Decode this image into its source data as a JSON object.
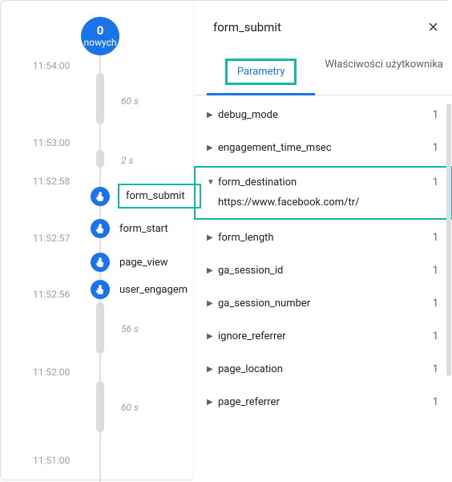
{
  "badge": {
    "count": "0",
    "label": "nowych"
  },
  "timestamps": {
    "t1": "11:54:00",
    "t2": "11:53:00",
    "t3": "11:52:58",
    "t4": "11:52:57",
    "t5": "11:52:56",
    "t6": "11:52:00",
    "t7": "11:51:00"
  },
  "gaps": {
    "g1": "60 s",
    "g2": "2 s",
    "g3": "56 s",
    "g4": "60 s"
  },
  "events": {
    "e1": "form_submit",
    "e2": "form_start",
    "e3": "page_view",
    "e4": "user_engagem"
  },
  "panel": {
    "title": "form_submit",
    "tab_params": "Parametry",
    "tab_user": "Właściwości użytkownika"
  },
  "params": {
    "debug_mode": {
      "k": "debug_mode",
      "c": "1"
    },
    "engagement_time_msec": {
      "k": "engagement_time_msec",
      "c": "1"
    },
    "form_destination": {
      "k": "form_destination",
      "c": "1",
      "v": "https://www.facebook.com/tr/"
    },
    "form_length": {
      "k": "form_length",
      "c": "1"
    },
    "ga_session_id": {
      "k": "ga_session_id",
      "c": "1"
    },
    "ga_session_number": {
      "k": "ga_session_number",
      "c": "1"
    },
    "ignore_referrer": {
      "k": "ignore_referrer",
      "c": "1"
    },
    "page_location": {
      "k": "page_location",
      "c": "1"
    },
    "page_referrer": {
      "k": "page_referrer",
      "c": "1"
    }
  }
}
